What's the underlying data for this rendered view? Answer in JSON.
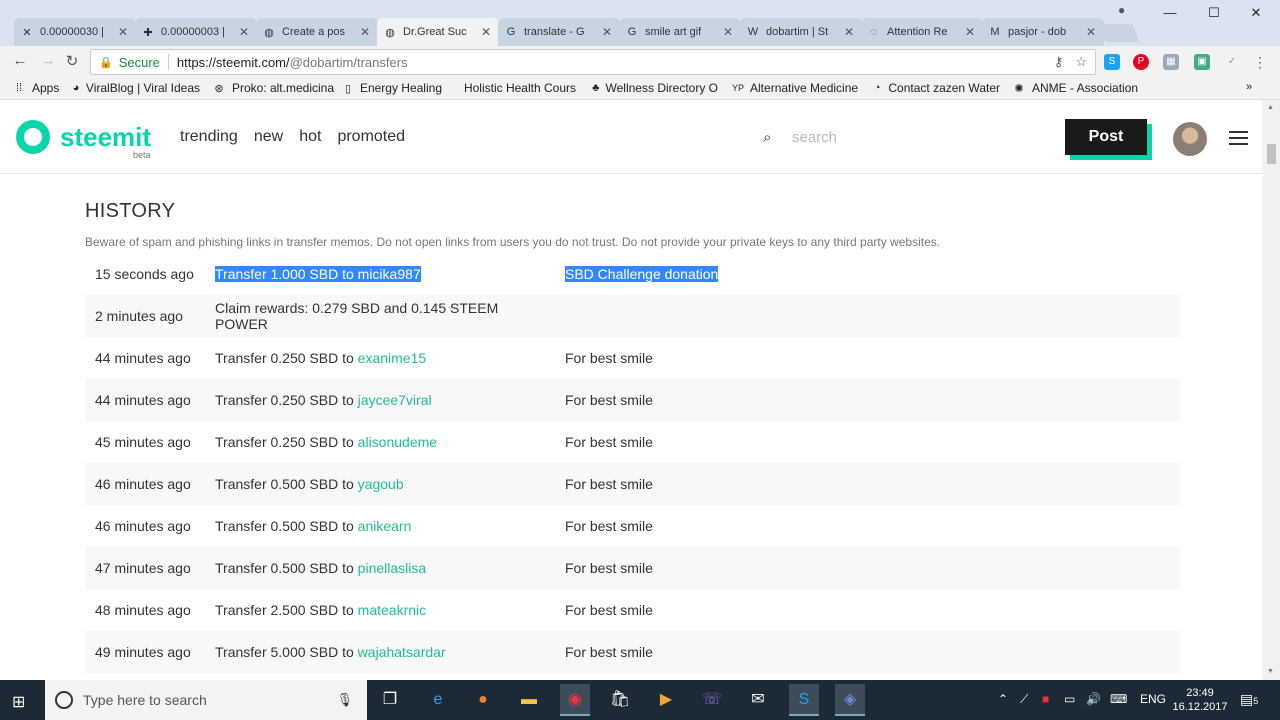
{
  "browser": {
    "tabs": [
      {
        "title": "0.00000030 |",
        "icon": "x-icon",
        "active": false
      },
      {
        "title": "0.00000003 |",
        "icon": "puzzle-icon",
        "active": false
      },
      {
        "title": "Create a pos",
        "icon": "steemit-icon",
        "active": false
      },
      {
        "title": "Dr.Great Suc",
        "icon": "steemit-icon",
        "active": true
      },
      {
        "title": "translate - G",
        "icon": "google-icon",
        "active": false
      },
      {
        "title": "smile art gif",
        "icon": "google-icon",
        "active": false
      },
      {
        "title": "dobartim | St",
        "icon": "wordpress-icon",
        "active": false
      },
      {
        "title": "Attention Re",
        "icon": "loader-icon",
        "active": false
      },
      {
        "title": "pasjor - dob",
        "icon": "gmail-icon",
        "active": false
      }
    ],
    "secure_label": "Secure",
    "url_host": "https://steemit.com/",
    "url_path": "@dobartim/transfers",
    "bookmarks": [
      {
        "label": "Apps",
        "icon": "apps-grid-icon"
      },
      {
        "label": "ViralBlog | Viral Ideas",
        "icon": "viralblog-icon"
      },
      {
        "label": "Proko: alt.medicina",
        "icon": "proko-icon"
      },
      {
        "label": "Energy Healing",
        "icon": "page-icon"
      },
      {
        "label": "Holistic Health Cours",
        "icon": "blank-icon"
      },
      {
        "label": "Wellness Directory O",
        "icon": "palm-icon"
      },
      {
        "label": "Alternative Medicine",
        "icon": "yp-icon"
      },
      {
        "label": "Contact zazen Water",
        "icon": "zazen-icon"
      },
      {
        "label": "ANME - Association",
        "icon": "anme-icon"
      }
    ]
  },
  "site": {
    "logo_text": "steemit",
    "logo_beta": "beta",
    "nav": [
      "trending",
      "new",
      "hot",
      "promoted"
    ],
    "search_placeholder": "search",
    "post_label": "Post",
    "accent_color": "#06d6a9"
  },
  "history": {
    "title": "HISTORY",
    "warning": "Beware of spam and phishing links in transfer memos. Do not open links from users you do not trust. Do not provide your private keys to any third party websites.",
    "rows": [
      {
        "time": "15 seconds ago",
        "desc_prefix": "Transfer 1.000 SBD to micika987",
        "link": "",
        "memo": "SBD Challenge donation",
        "selected": true
      },
      {
        "time": "2 minutes ago",
        "desc_prefix": "Claim rewards: 0.279 SBD and 0.145 STEEM POWER",
        "link": "",
        "memo": "",
        "selected": false
      },
      {
        "time": "44 minutes ago",
        "desc_prefix": "Transfer 0.250 SBD to ",
        "link": "exanime15",
        "memo": "For best smile",
        "selected": false
      },
      {
        "time": "44 minutes ago",
        "desc_prefix": "Transfer 0.250 SBD to ",
        "link": "jaycee7viral",
        "memo": "For best smile",
        "selected": false
      },
      {
        "time": "45 minutes ago",
        "desc_prefix": "Transfer 0.250 SBD to ",
        "link": "alisonudeme",
        "memo": "For best smile",
        "selected": false
      },
      {
        "time": "46 minutes ago",
        "desc_prefix": "Transfer 0.500 SBD to ",
        "link": "yagoub",
        "memo": "For best smile",
        "selected": false
      },
      {
        "time": "46 minutes ago",
        "desc_prefix": "Transfer 0.500 SBD to ",
        "link": "anikearn",
        "memo": "For best smile",
        "selected": false
      },
      {
        "time": "47 minutes ago",
        "desc_prefix": "Transfer 0.500 SBD to ",
        "link": "pinellaslisa",
        "memo": "For best smile",
        "selected": false
      },
      {
        "time": "48 minutes ago",
        "desc_prefix": "Transfer 2.500 SBD to ",
        "link": "mateakrnic",
        "memo": "For best smile",
        "selected": false
      },
      {
        "time": "49 minutes ago",
        "desc_prefix": "Transfer 5.000 SBD to ",
        "link": "wajahatsardar",
        "memo": "For best smile",
        "selected": false
      }
    ]
  },
  "taskbar": {
    "search_placeholder": "Type here to search",
    "language": "ENG",
    "time": "23:49",
    "date": "16.12.2017",
    "notification_count": "5"
  }
}
